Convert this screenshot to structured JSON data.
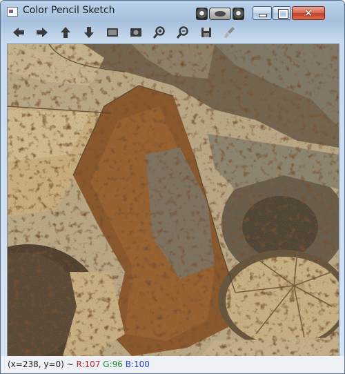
{
  "window": {
    "title": "Color Pencil Sketch",
    "close_glyph": "✕"
  },
  "toolbar": {
    "buttons": [
      {
        "icon": "arrow-left-icon"
      },
      {
        "icon": "arrow-right-icon"
      },
      {
        "icon": "arrow-up-icon"
      },
      {
        "icon": "arrow-down-icon"
      },
      {
        "icon": "image-icon"
      },
      {
        "icon": "zoom-fit-icon"
      },
      {
        "icon": "zoom-in-icon"
      },
      {
        "icon": "zoom-out-icon"
      },
      {
        "icon": "save-icon"
      },
      {
        "icon": "properties-icon"
      }
    ],
    "icon_color": "#3a3a3a"
  },
  "status": {
    "coords": "(x=238, y=0) ~ ",
    "r": "R:107",
    "g": "G:96",
    "b": "B:100",
    "r_color": "#c0202a",
    "g_color": "#1f8a2a",
    "b_color": "#2040c8"
  },
  "colors": {
    "titlebar": "#b9d1ea",
    "close_button": "#c4402a"
  }
}
